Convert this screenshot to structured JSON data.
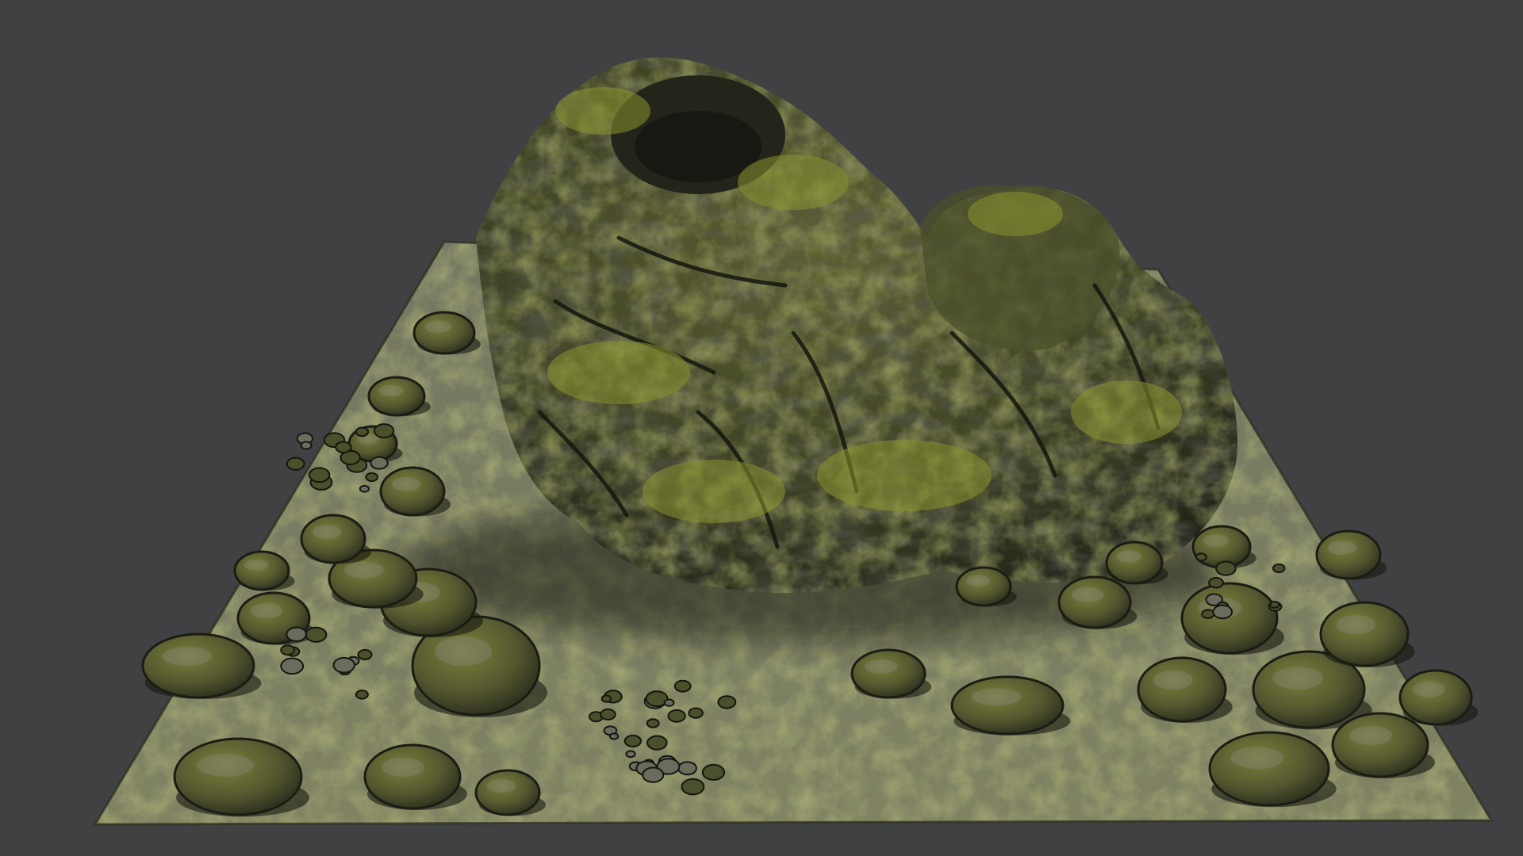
{
  "scene": {
    "subject": "mossy-rock-terrain-tile",
    "colors": {
      "background": "#404142",
      "moss": "#7f8a2a",
      "moss_light": "#a6ad33",
      "rock": "#6f6f6c",
      "rock_dark": "#3b3a33",
      "shadow": "#1f1f1b"
    }
  }
}
